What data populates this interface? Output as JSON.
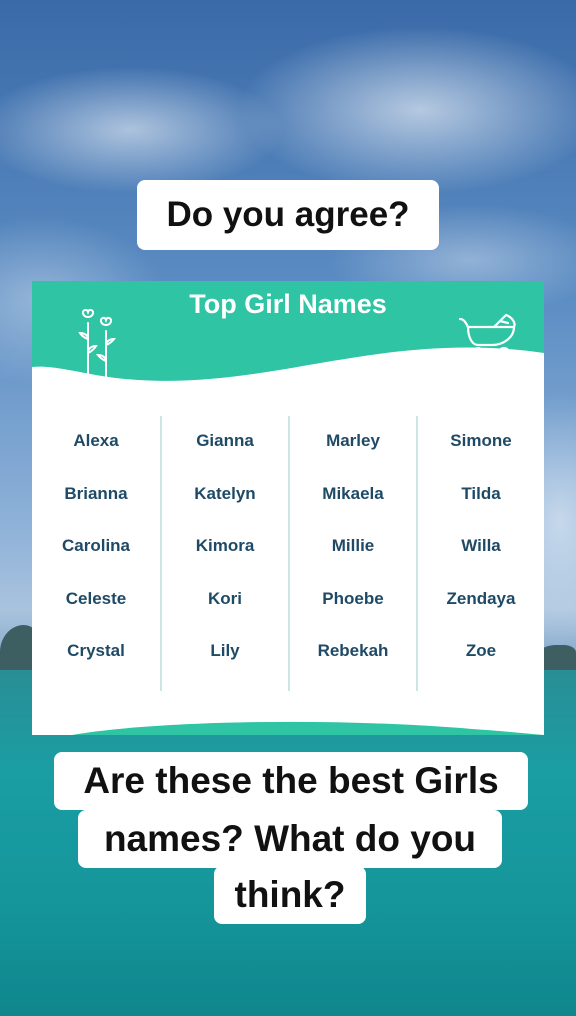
{
  "captions": {
    "top": "Do you agree?",
    "bottom_lines": [
      "Are these the best Girls",
      "names? What do you",
      "think?"
    ]
  },
  "card": {
    "title": "Top Girl Names",
    "accent_color": "#2ec4a4",
    "columns": [
      [
        "Alexa",
        "Brianna",
        "Carolina",
        "Celeste",
        "Crystal"
      ],
      [
        "Gianna",
        "Katelyn",
        "Kimora",
        "Kori",
        "Lily"
      ],
      [
        "Marley",
        "Mikaela",
        "Millie",
        "Phoebe",
        "Rebekah"
      ],
      [
        "Simone",
        "Tilda",
        "Willa",
        "Zendaya",
        "Zoe"
      ]
    ],
    "icons": [
      "flower-icon",
      "stroller-icon"
    ]
  }
}
